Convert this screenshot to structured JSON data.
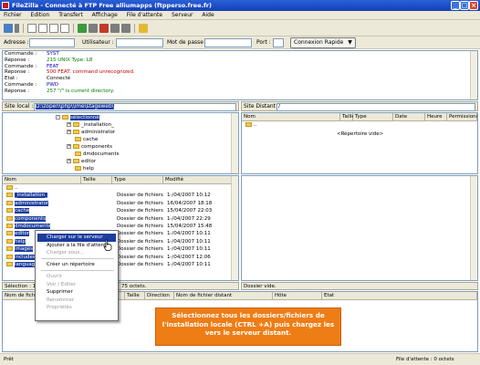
{
  "window": {
    "title": "FileZilla - Connecté à FTP Free alliumapps (ftpperso.free.fr)",
    "controls": [
      "_",
      "□",
      "×"
    ]
  },
  "menu": [
    "Fichier",
    "Edition",
    "Transfert",
    "Affichage",
    "File d'attente",
    "Serveur",
    "Aide"
  ],
  "toolbar": {
    "icons": [
      "site-manager-icon",
      "dropdown-icon",
      "message-log-icon",
      "local-tree-icon",
      "remote-tree-icon",
      "queue-icon",
      "refresh-icon",
      "process-queue-icon",
      "cancel-icon",
      "disconnect-icon",
      "reconnect-icon",
      "filter-icon",
      "compare-icon"
    ]
  },
  "quickconnect": {
    "host_label": "Adresse :",
    "user_label": "Utilisateur :",
    "pass_label": "Mot de passe :",
    "port_label": "Port :",
    "host_value": "",
    "user_value": "",
    "pass_value": "",
    "port_value": "",
    "button_label": "Connexion Rapide",
    "dropdown_glyph": "▼"
  },
  "log": [
    {
      "key": "Commande :",
      "text": "SYST",
      "color": "c-blue"
    },
    {
      "key": "Réponse :",
      "text": "215 UNIX Type: L8",
      "color": "c-green"
    },
    {
      "key": "Commande :",
      "text": "FEAT",
      "color": "c-blue"
    },
    {
      "key": "Réponse :",
      "text": "500 FEAT: command unrecognized.",
      "color": "c-red"
    },
    {
      "key": "Etat :",
      "text": "Connecté",
      "color": "c-black"
    },
    {
      "key": "Commande :",
      "text": "PWD",
      "color": "c-blue"
    },
    {
      "key": "Réponse :",
      "text": "257 \"/\" is current directory.",
      "color": "c-green"
    }
  ],
  "local": {
    "site_label": "Site local :",
    "path": "D:\\zopen\\php\\\\ime\\stageweb\\",
    "tree": [
      {
        "label": "sélectionné",
        "selected": true,
        "indent": 0,
        "plus": true
      },
      {
        "label": "_installation_",
        "selected": false,
        "indent": 1,
        "plus": true
      },
      {
        "label": "administrator",
        "selected": false,
        "indent": 1,
        "plus": true
      },
      {
        "label": "cache",
        "selected": false,
        "indent": 1,
        "plus": false
      },
      {
        "label": "components",
        "selected": false,
        "indent": 1,
        "plus": true
      },
      {
        "label": "dmdocuments",
        "selected": false,
        "indent": 1,
        "plus": false
      },
      {
        "label": "editor",
        "selected": false,
        "indent": 1,
        "plus": true
      },
      {
        "label": "help",
        "selected": false,
        "indent": 1,
        "plus": false
      }
    ],
    "headers": {
      "name": "Nom",
      "size": "Taille",
      "type": "Type",
      "modified": "Modifié"
    },
    "files": [
      {
        "name": "..",
        "type": "",
        "date": "",
        "selected": false
      },
      {
        "name": "_installation_",
        "type": "Dossier de fichiers",
        "date": "1-/04/2007 10:12",
        "selected": true
      },
      {
        "name": "administrator",
        "type": "Dossier de fichiers",
        "date": "16/04/2007 18:18",
        "selected": true
      },
      {
        "name": "cache",
        "type": "Dossier de fichiers",
        "date": "15/04/2007 22:03",
        "selected": true
      },
      {
        "name": "components",
        "type": "Dossier de fichiers",
        "date": "1-/04/2007 22:29",
        "selected": true
      },
      {
        "name": "dmdocuments",
        "type": "Dossier de fichiers",
        "date": "15/04/2007 15:48",
        "selected": true
      },
      {
        "name": "editor",
        "type": "Dossier de fichiers",
        "date": "1-/04/2007 10:11",
        "selected": true
      },
      {
        "name": "help",
        "type": "Dossier de fichiers",
        "date": "1-/04/2007 10:11",
        "selected": true
      },
      {
        "name": "images",
        "type": "Dossier de fichiers",
        "date": "1-/04/2007 10:11",
        "selected": true
      },
      {
        "name": "includes",
        "type": "Dossier de fichiers",
        "date": "1-/04/2007 12:06",
        "selected": true
      },
      {
        "name": "language",
        "type": "Dossier de fichiers",
        "date": "1-/04/2007 10:11",
        "selected": true
      }
    ],
    "selection_status": "Sélection : 15",
    "selection_status_right": "75 octets."
  },
  "remote": {
    "site_label": "Site Distant :",
    "path": "/",
    "headers": {
      "name": "Nom",
      "size": "Taille",
      "type": "Type",
      "date": "Date",
      "time": "Heure",
      "perms": "Permissions"
    },
    "files": [
      ".."
    ],
    "empty_text": "<Répertoire vide>",
    "status": "Dossier vide."
  },
  "context_menu": [
    {
      "label": "Charger sur le serveur",
      "state": "hl"
    },
    {
      "label": "Ajouter à la file d'attente",
      "state": "normal"
    },
    {
      "label": "Charger sous...",
      "state": "dis"
    },
    {
      "sep": true
    },
    {
      "label": "Créer un répertoire",
      "state": "normal"
    },
    {
      "sep": true
    },
    {
      "label": "Ouvrir",
      "state": "dis"
    },
    {
      "label": "Voir / Editer",
      "state": "dis"
    },
    {
      "label": "Supprimer",
      "state": "normal"
    },
    {
      "label": "Renommer",
      "state": "dis"
    },
    {
      "label": "Propriétés",
      "state": "dis"
    }
  ],
  "queue": {
    "headers": {
      "local": "Nom de fichier local",
      "size": "Taille",
      "direction": "Direction",
      "remote": "Nom de fichier distant",
      "host": "Hôte",
      "status": "Etat"
    }
  },
  "callout": {
    "line1": "Sélectionnez tous les dossiers/fichiers de",
    "line2": "l'installation locale (CTRL +A) puis chargez les",
    "line3": "vers le serveur distant."
  },
  "statusbar": {
    "left": "Prêt",
    "right": "File d'attente : 0 octets"
  }
}
